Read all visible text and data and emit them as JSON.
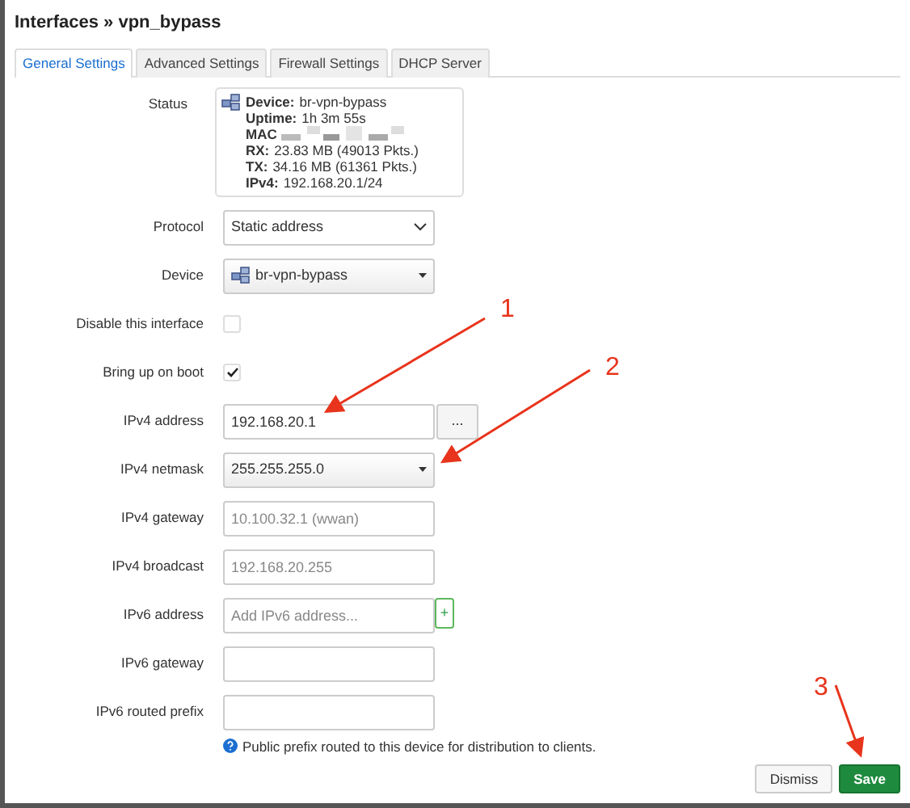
{
  "title": "Interfaces » vpn_bypass",
  "tabs": [
    {
      "label": "General Settings",
      "selected": true
    },
    {
      "label": "Advanced Settings",
      "selected": false
    },
    {
      "label": "Firewall Settings",
      "selected": false
    },
    {
      "label": "DHCP Server",
      "selected": false
    }
  ],
  "status": {
    "label": "Status",
    "lines": [
      {
        "key": "Device:",
        "value": "br-vpn-bypass"
      },
      {
        "key": "Uptime:",
        "value": "1h 3m 55s"
      },
      {
        "key": "MAC",
        "redacted": true
      },
      {
        "key": "RX:",
        "value": "23.83 MB (49013 Pkts.)"
      },
      {
        "key": "TX:",
        "value": "34.16 MB (61361 Pkts.)"
      },
      {
        "key": "IPv4:",
        "value": "192.168.20.1/24"
      }
    ]
  },
  "fields": [
    {
      "kind": "select",
      "label": "Protocol",
      "value": "Static address"
    },
    {
      "kind": "device",
      "label": "Device",
      "value": "br-vpn-bypass"
    },
    {
      "kind": "checkbox",
      "label": "Disable this interface",
      "checked": false
    },
    {
      "kind": "checkbox",
      "label": "Bring up on boot",
      "checked": true
    },
    {
      "kind": "input-more",
      "label": "IPv4 address",
      "value": "192.168.20.1",
      "button": "..."
    },
    {
      "kind": "dropdown",
      "label": "IPv4 netmask",
      "value": "255.255.255.0"
    },
    {
      "kind": "input",
      "label": "IPv4 gateway",
      "placeholder": "10.100.32.1 (wwan)"
    },
    {
      "kind": "input",
      "label": "IPv4 broadcast",
      "placeholder": "192.168.20.255"
    },
    {
      "kind": "input-add",
      "label": "IPv6 address",
      "placeholder": "Add IPv6 address...",
      "button": "+"
    },
    {
      "kind": "input",
      "label": "IPv6 gateway"
    },
    {
      "kind": "input",
      "label": "IPv6 routed prefix",
      "help": "Public prefix routed to this device for distribution to clients."
    }
  ],
  "buttons": [
    {
      "label": "Dismiss",
      "kind": "default"
    },
    {
      "label": "Save",
      "kind": "primary"
    }
  ],
  "annotations": [
    {
      "label": "1"
    },
    {
      "label": "2"
    },
    {
      "label": "3"
    }
  ]
}
